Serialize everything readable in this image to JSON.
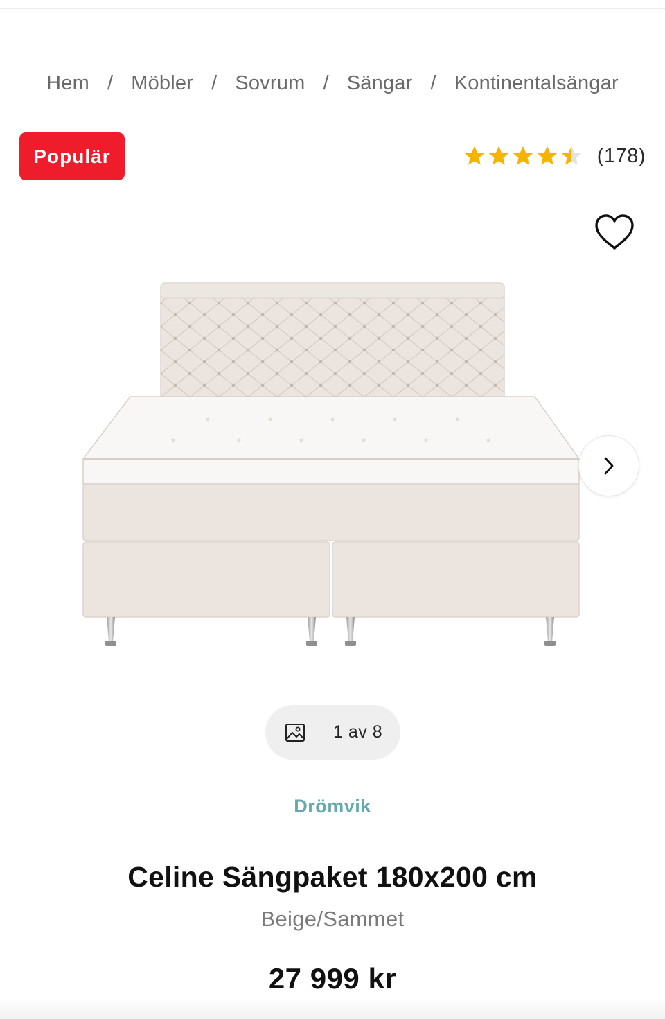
{
  "breadcrumb": {
    "items": [
      "Hem",
      "Möbler",
      "Sovrum",
      "Sängar",
      "Kontinentalsängar"
    ],
    "separator": "/"
  },
  "badge": {
    "label": "Populär",
    "color": "#ef1c2b"
  },
  "rating": {
    "value": 4.5,
    "max": 5,
    "count_text": "(178)",
    "star_color": "#f5b400"
  },
  "gallery": {
    "counter_text": "1 av 8",
    "current": 1,
    "total": 8
  },
  "product": {
    "brand": "Drömvik",
    "title": "Celine Sängpaket 180x200 cm",
    "variant": "Beige/Sammet",
    "price": "27 999 kr"
  },
  "icons": {
    "wishlist": "heart-icon",
    "next": "chevron-right-icon",
    "gallery": "image-icon"
  },
  "colors": {
    "brand": "#63a9ad",
    "bed_fabric": "#ebe4df"
  }
}
